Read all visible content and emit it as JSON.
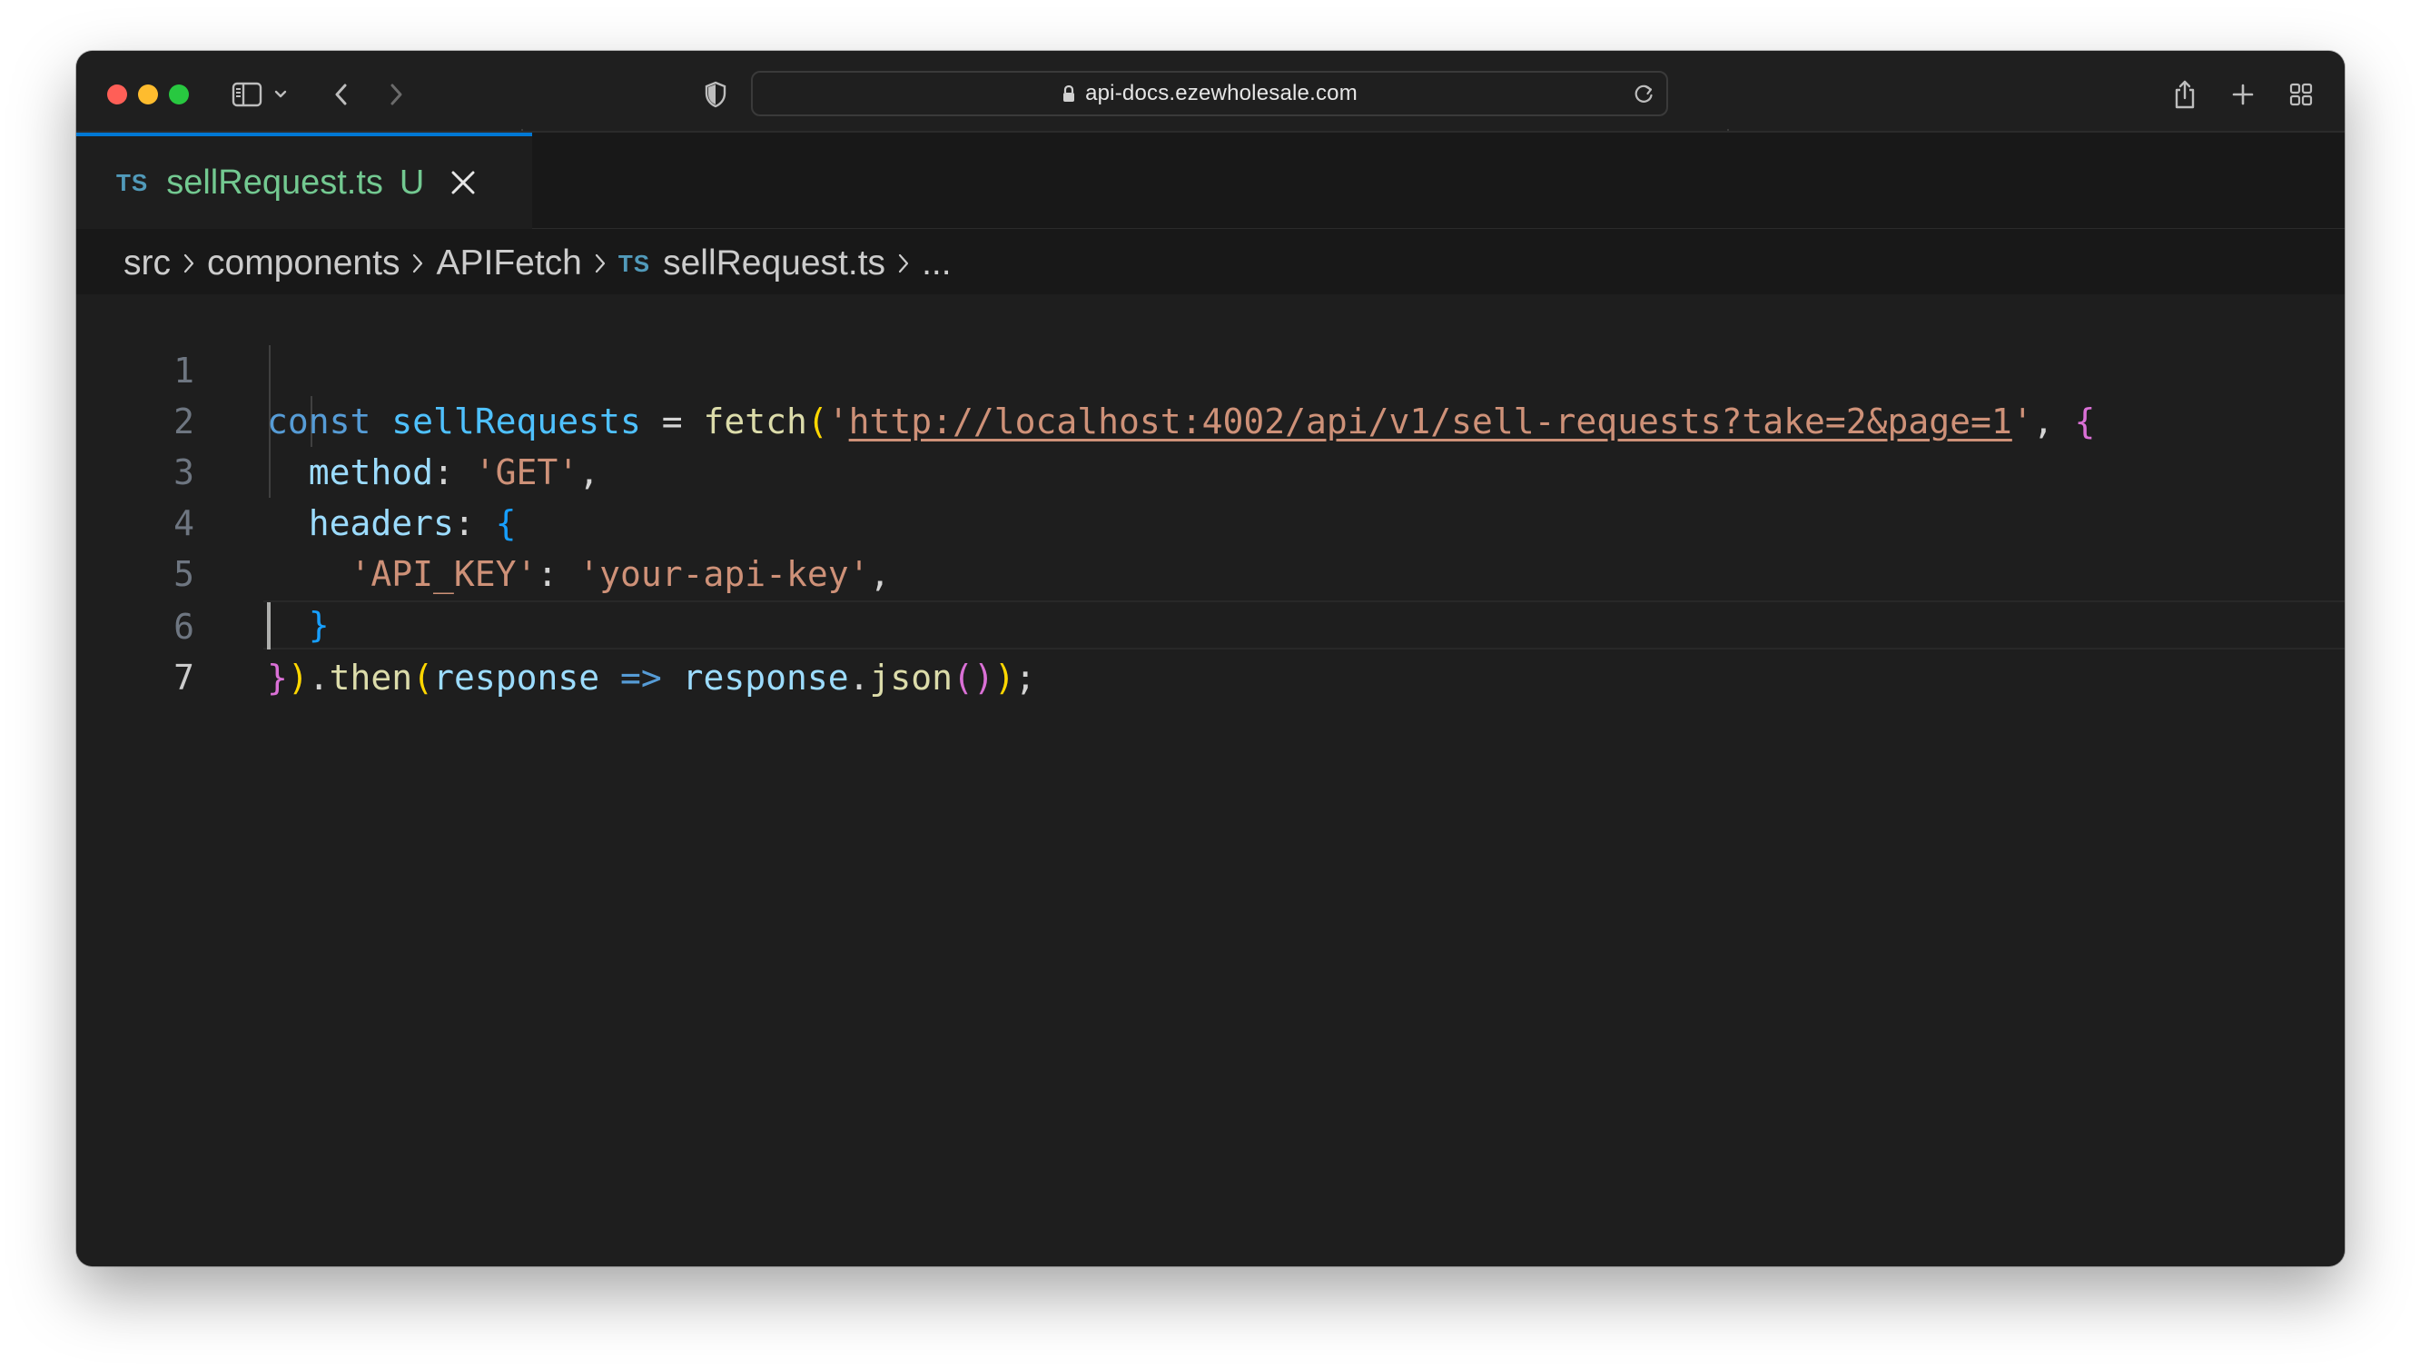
{
  "browser": {
    "url": "api-docs.ezewholesale.com"
  },
  "tab": {
    "language_badge": "TS",
    "filename": "sellRequest.ts",
    "status": "U"
  },
  "breadcrumb": {
    "items": [
      "src",
      "components",
      "APIFetch"
    ],
    "file_badge": "TS",
    "file": "sellRequest.ts",
    "ellipsis": "..."
  },
  "editor": {
    "line_numbers": [
      "1",
      "2",
      "3",
      "4",
      "5",
      "6",
      "7"
    ],
    "active_line": 7,
    "lines": [
      [
        {
          "cls": "t-kw",
          "text": "const "
        },
        {
          "cls": "t-var",
          "text": "sellRequests"
        },
        {
          "cls": "t-op",
          "text": " = "
        },
        {
          "cls": "t-fn",
          "text": "fetch"
        },
        {
          "cls": "t-b1",
          "text": "("
        },
        {
          "cls": "t-str",
          "text": "'"
        },
        {
          "cls": "t-url",
          "text": "http://localhost:4002/api/v1/sell-requests?take=2&page=1"
        },
        {
          "cls": "t-str",
          "text": "'"
        },
        {
          "cls": "t-punct",
          "text": ", "
        },
        {
          "cls": "t-b2",
          "text": "{"
        }
      ],
      [
        {
          "cls": "t-prop",
          "text": "  method"
        },
        {
          "cls": "t-punct",
          "text": ": "
        },
        {
          "cls": "t-str",
          "text": "'GET'"
        },
        {
          "cls": "t-punct",
          "text": ","
        }
      ],
      [
        {
          "cls": "t-prop",
          "text": "  headers"
        },
        {
          "cls": "t-punct",
          "text": ": "
        },
        {
          "cls": "t-b3",
          "text": "{"
        }
      ],
      [
        {
          "cls": "t-str",
          "text": "    'API_KEY'"
        },
        {
          "cls": "t-punct",
          "text": ": "
        },
        {
          "cls": "t-str",
          "text": "'your-api-key'"
        },
        {
          "cls": "t-punct",
          "text": ","
        }
      ],
      [
        {
          "cls": "t-b3",
          "text": "  }"
        }
      ],
      [
        {
          "cls": "t-b2",
          "text": "}"
        },
        {
          "cls": "t-b1",
          "text": ")"
        },
        {
          "cls": "t-punct",
          "text": "."
        },
        {
          "cls": "t-fn",
          "text": "then"
        },
        {
          "cls": "t-b1",
          "text": "("
        },
        {
          "cls": "t-param",
          "text": "response"
        },
        {
          "cls": "t-kw",
          "text": " => "
        },
        {
          "cls": "t-param",
          "text": "response"
        },
        {
          "cls": "t-punct",
          "text": "."
        },
        {
          "cls": "t-fn",
          "text": "json"
        },
        {
          "cls": "t-b2",
          "text": "()"
        },
        {
          "cls": "t-b1",
          "text": ")"
        },
        {
          "cls": "t-punct",
          "text": ";"
        }
      ],
      []
    ]
  }
}
